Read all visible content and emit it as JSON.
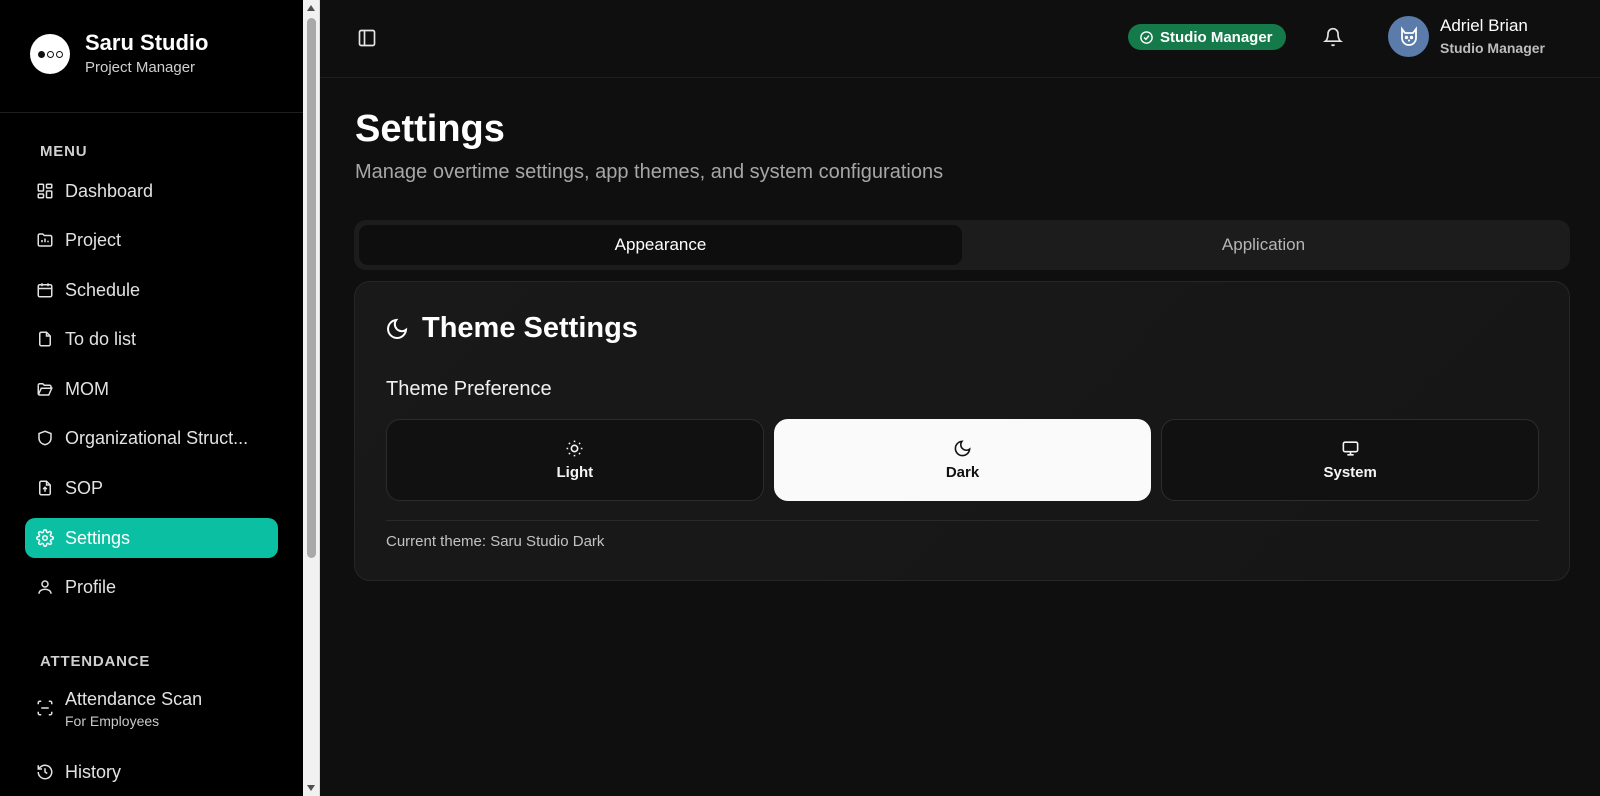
{
  "brand": {
    "name": "Saru Studio",
    "subtitle": "Project Manager"
  },
  "menu": {
    "label": "MENU",
    "items": [
      {
        "label": "Dashboard",
        "icon": "dashboard-icon"
      },
      {
        "label": "Project",
        "icon": "project-icon"
      },
      {
        "label": "Schedule",
        "icon": "calendar-icon"
      },
      {
        "label": "To do list",
        "icon": "document-icon"
      },
      {
        "label": "MOM",
        "icon": "folder-open-icon"
      },
      {
        "label": "Organizational Struct...",
        "icon": "shield-icon"
      },
      {
        "label": "SOP",
        "icon": "file-upload-icon"
      },
      {
        "label": "Settings",
        "icon": "gear-icon",
        "active": true
      },
      {
        "label": "Profile",
        "icon": "user-icon"
      }
    ]
  },
  "attendance": {
    "label": "ATTENDANCE",
    "items": [
      {
        "label": "Attendance Scan",
        "sub": "For Employees",
        "icon": "scan-icon"
      },
      {
        "label": "History",
        "icon": "history-icon"
      }
    ]
  },
  "header": {
    "role_badge": "Studio Manager",
    "user_name": "Adriel Brian",
    "user_role": "Studio Manager"
  },
  "page": {
    "title": "Settings",
    "subtitle": "Manage overtime settings, app themes, and system configurations"
  },
  "tabs": [
    {
      "label": "Appearance",
      "active": true
    },
    {
      "label": "Application",
      "active": false
    }
  ],
  "theme_card": {
    "title": "Theme Settings",
    "preference_label": "Theme Preference",
    "options": [
      {
        "label": "Light",
        "icon": "sun-icon"
      },
      {
        "label": "Dark",
        "icon": "moon-icon",
        "selected": true
      },
      {
        "label": "System",
        "icon": "monitor-icon"
      }
    ],
    "current_theme": "Current theme: Saru Studio Dark"
  },
  "colors": {
    "accent": "#0bbfa3",
    "badge": "#157a4a",
    "avatar": "#5b7caa"
  }
}
